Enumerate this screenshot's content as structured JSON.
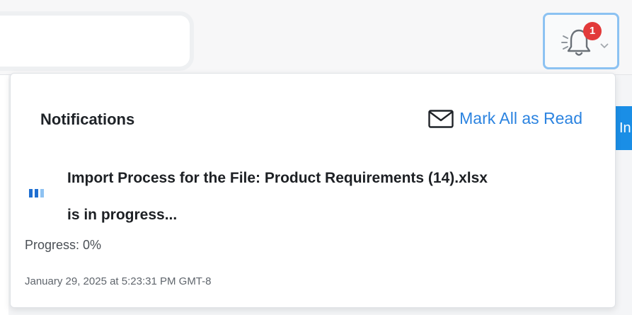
{
  "header": {
    "notifications_badge_count": "1"
  },
  "background": {
    "tab_text": "In"
  },
  "panel": {
    "title": "Notifications",
    "mark_all_label": "Mark All as Read",
    "notification": {
      "message_line1": "Import Process for the File: Product Requirements (14).xlsx",
      "message_line2": "is in progress...",
      "progress_label": "Progress: 0%",
      "progress_value": 0,
      "timestamp": "January 29, 2025 at 5:23:31 PM GMT-8"
    }
  },
  "colors": {
    "accent_blue": "#2b83e0",
    "badge_red": "#e23a3a",
    "focus_ring": "#8cc2f2",
    "background_tab_blue": "#1a8ee6"
  },
  "icons": {
    "bell": "bell-icon",
    "chevron": "chevron-down-icon",
    "envelope": "envelope-icon",
    "progress": "progress-bars-icon"
  }
}
